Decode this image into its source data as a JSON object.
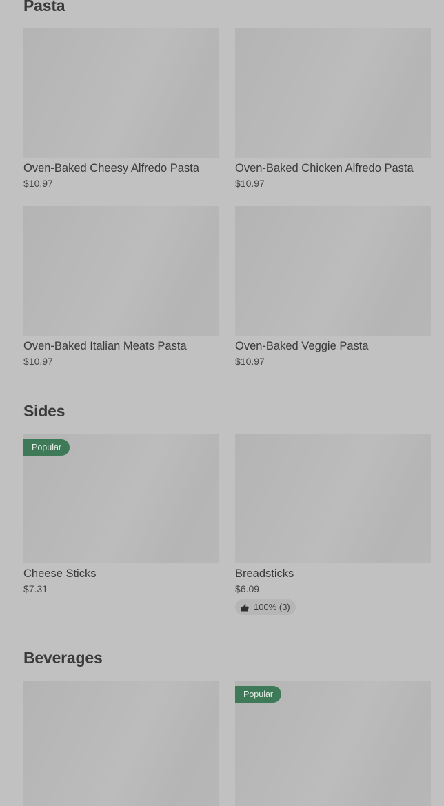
{
  "sections": [
    {
      "title": "Pasta",
      "items": [
        {
          "name": "Oven-Baked Cheesy Alfredo Pasta",
          "price": "$10.97"
        },
        {
          "name": "Oven-Baked Chicken Alfredo Pasta",
          "price": "$10.97"
        },
        {
          "name": "Oven-Baked Italian Meats Pasta",
          "price": "$10.97"
        },
        {
          "name": "Oven-Baked Veggie Pasta",
          "price": "$10.97"
        }
      ]
    },
    {
      "title": "Sides",
      "items": [
        {
          "name": "Cheese Sticks",
          "price": "$7.31",
          "badge": "Popular"
        },
        {
          "name": "Breadsticks",
          "price": "$6.09",
          "rating": "100% (3)",
          "rating_icon": "thumbs-up-icon"
        }
      ]
    },
    {
      "title": "Beverages",
      "items": [
        {},
        {
          "badge": "Popular"
        }
      ]
    }
  ],
  "colors": {
    "background": "#c1c1c1",
    "image_placeholder": "#b8b8b8",
    "badge": "#3e7a58",
    "text": "#3a3a3a"
  }
}
